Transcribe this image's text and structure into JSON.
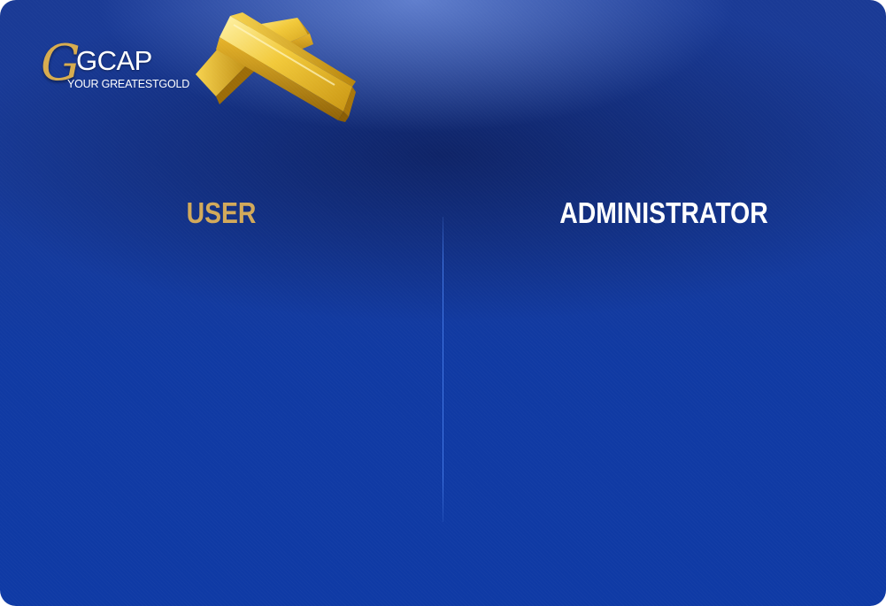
{
  "brand": {
    "logo_mark": "G",
    "name": "GCAP",
    "tagline": "YOUR GREATESTGOLD",
    "gold_color": "#d7ac4f"
  },
  "decoration": {
    "gold_bars_icon": "gold-bars-icon"
  },
  "tabs": {
    "user_label": "USER",
    "administrator_label": "ADMINISTRATOR",
    "active": "USER",
    "active_color": "#d2a95a",
    "inactive_color": "#ffffff"
  },
  "colors": {
    "background": "#103aa3",
    "divider": "#467de0"
  }
}
